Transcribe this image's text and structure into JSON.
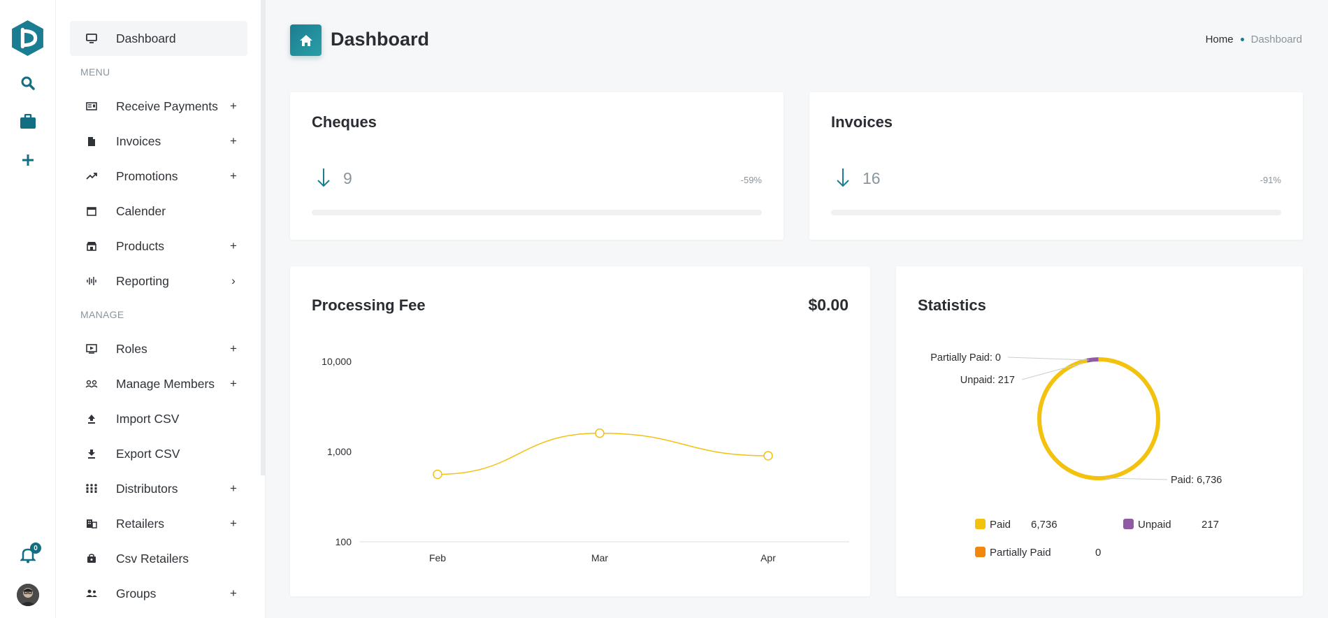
{
  "header": {
    "title": "Dashboard",
    "breadcrumb": {
      "home": "Home",
      "current": "Dashboard"
    }
  },
  "rail": {
    "notification_count": "0",
    "icons": [
      "logo-icon",
      "search-icon",
      "briefcase-icon",
      "plus-icon",
      "bell-icon",
      "avatar"
    ]
  },
  "sidebar": {
    "top_item": {
      "label": "Dashboard",
      "icon": "monitor-icon"
    },
    "sections": [
      {
        "label": "MENU"
      },
      {
        "label": "MANAGE"
      }
    ],
    "items": [
      {
        "label": "Receive Payments",
        "icon": "payments-icon",
        "action": "+"
      },
      {
        "label": "Invoices",
        "icon": "document-icon",
        "action": "+"
      },
      {
        "label": "Promotions",
        "icon": "trending-icon",
        "action": "+"
      },
      {
        "label": "Calender",
        "icon": "calendar-icon",
        "action": ""
      },
      {
        "label": "Products",
        "icon": "store-icon",
        "action": "+"
      },
      {
        "label": "Reporting",
        "icon": "waveform-icon",
        "action": "›"
      },
      {
        "label": "Roles",
        "icon": "video-icon",
        "action": "+"
      },
      {
        "label": "Manage Members",
        "icon": "members-icon",
        "action": "+"
      },
      {
        "label": "Import CSV",
        "icon": "upload-icon",
        "action": ""
      },
      {
        "label": "Export CSV",
        "icon": "download-icon",
        "action": ""
      },
      {
        "label": "Distributors",
        "icon": "distributors-icon",
        "action": "+"
      },
      {
        "label": "Retailers",
        "icon": "building-icon",
        "action": "+"
      },
      {
        "label": "Csv Retailers",
        "icon": "bag-icon",
        "action": ""
      },
      {
        "label": "Groups",
        "icon": "people-icon",
        "action": "+"
      }
    ]
  },
  "cards": {
    "cheques": {
      "title": "Cheques",
      "value": "9",
      "change": "-59%",
      "progress": 0
    },
    "invoices": {
      "title": "Invoices",
      "value": "16",
      "change": "-91%",
      "progress": 0
    }
  },
  "processing_fee": {
    "title": "Processing Fee",
    "amount": "$0.00"
  },
  "statistics": {
    "title": "Statistics"
  },
  "chart_data": [
    {
      "type": "line",
      "title": "Processing Fee",
      "categories": [
        "Feb",
        "Mar",
        "Apr"
      ],
      "y_scale": "log",
      "ylim": [
        100,
        10000
      ],
      "y_ticks": [
        "100",
        "1,000",
        "10,000"
      ],
      "series": [
        {
          "values": [
            560,
            1600,
            900
          ],
          "color": "#f2c20f"
        }
      ]
    },
    {
      "type": "pie",
      "title": "Statistics",
      "variant": "donut",
      "legend_position": "bottom",
      "slices": [
        {
          "label": "Paid",
          "value": 6736,
          "display": "6,736",
          "callout": "Paid: 6,736",
          "color": "#f2c20f"
        },
        {
          "label": "Unpaid",
          "value": 217,
          "display": "217",
          "callout": "Unpaid: 217",
          "color": "#8e5ba4"
        },
        {
          "label": "Partially Paid",
          "value": 0,
          "display": "0",
          "callout": "Partially Paid: 0",
          "color": "#f2870f"
        }
      ]
    }
  ]
}
